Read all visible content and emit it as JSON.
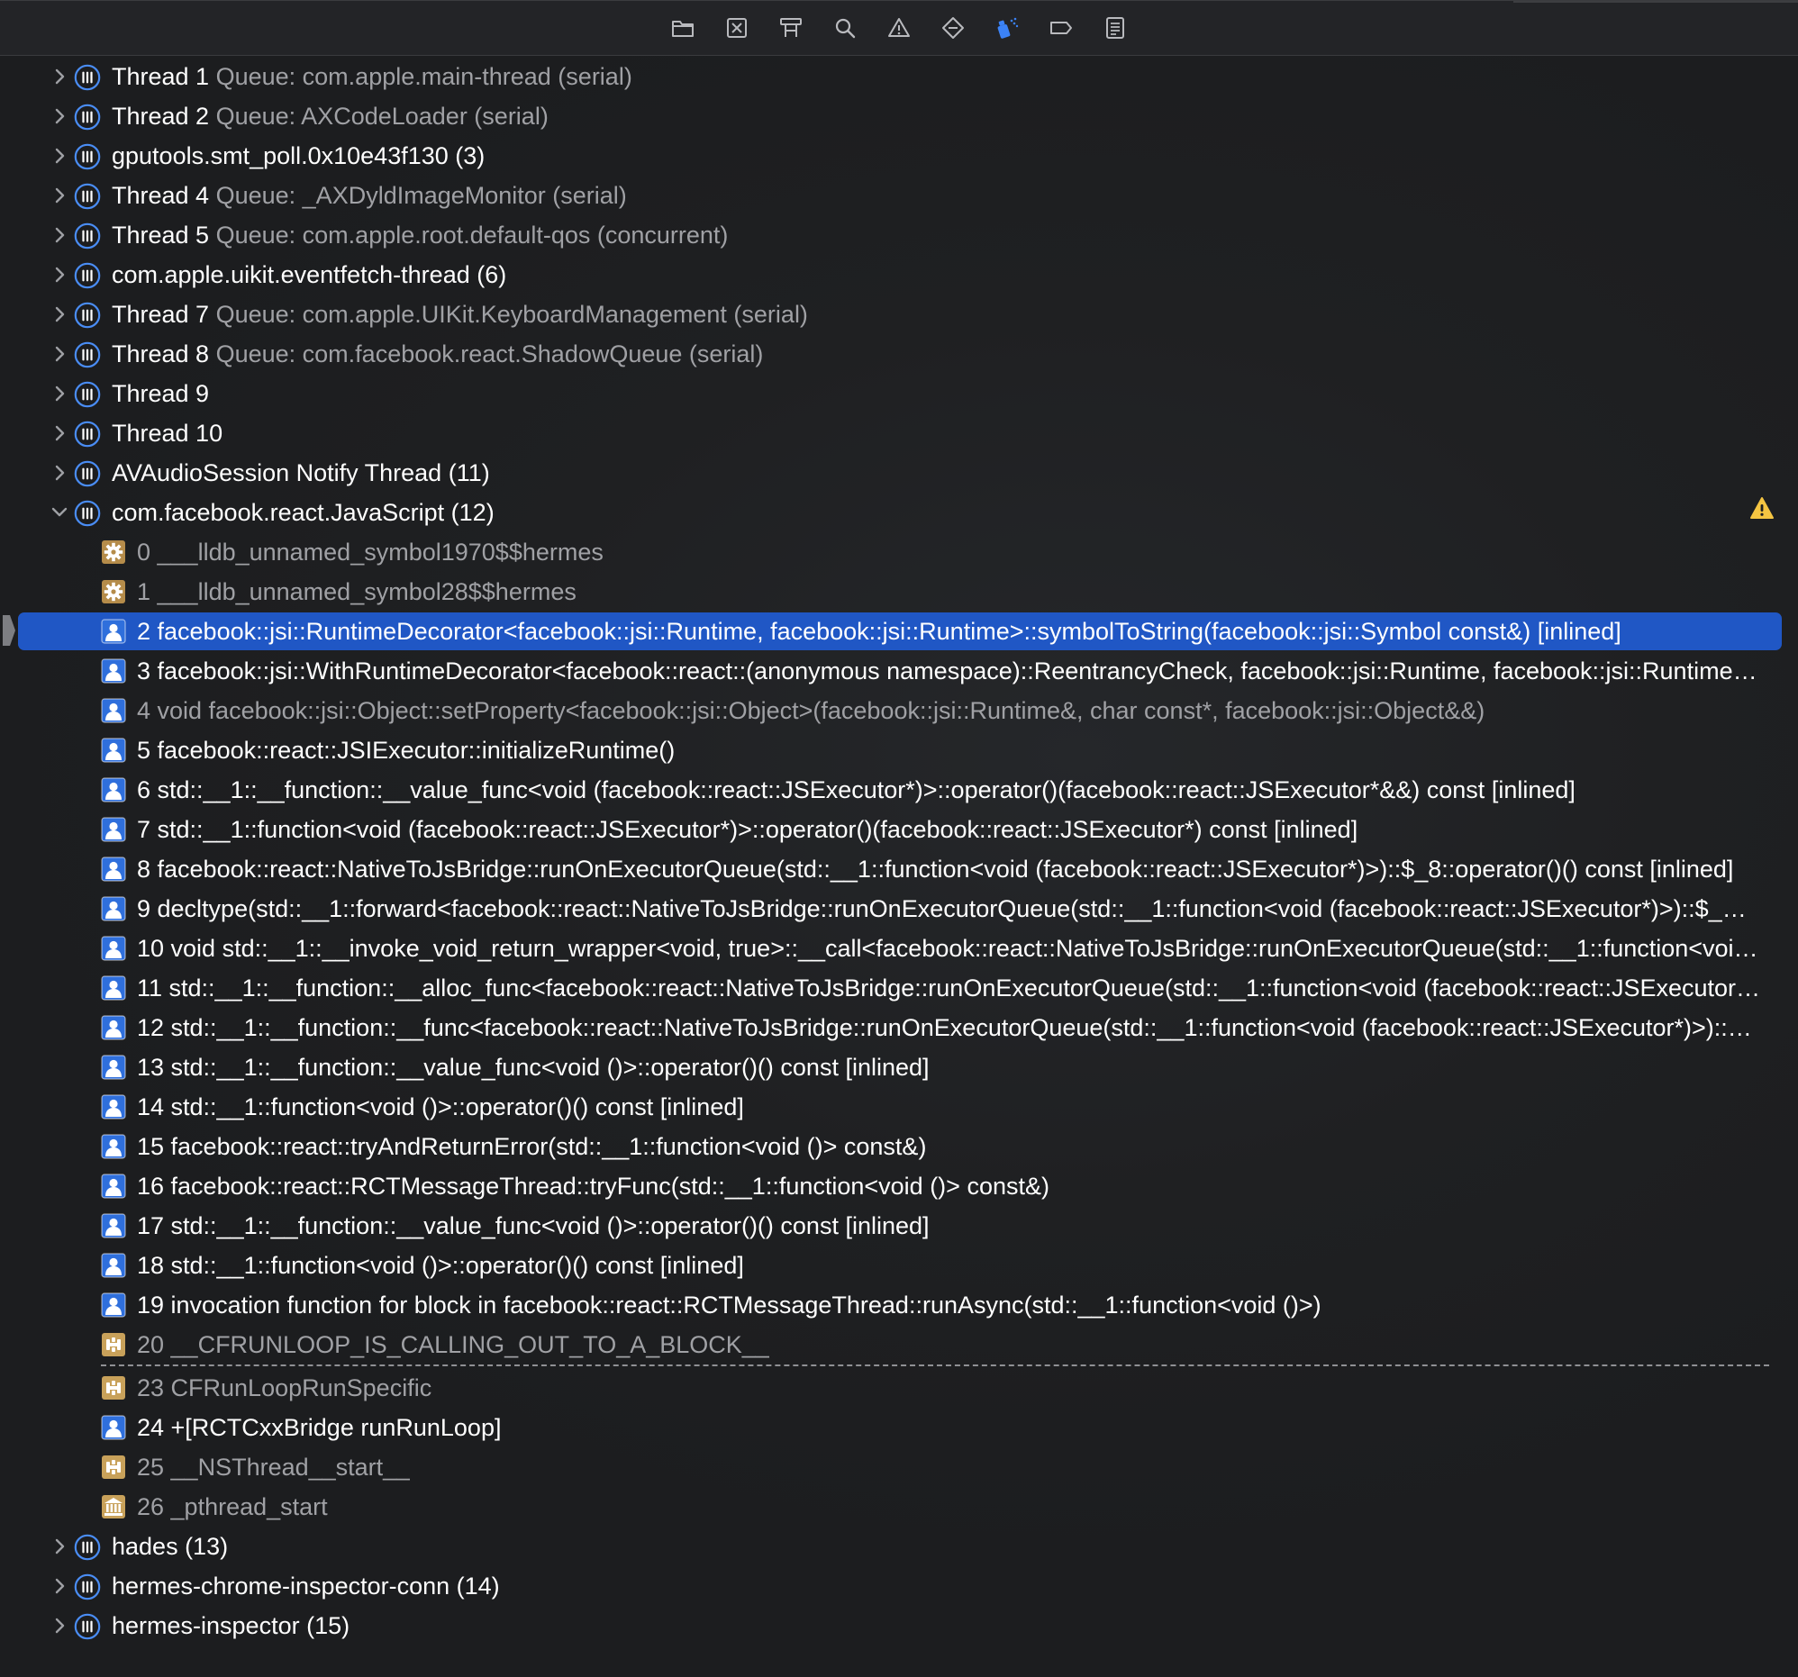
{
  "toolbar": {
    "buttons": [
      {
        "name": "project-navigator",
        "icon": "folder-icon"
      },
      {
        "name": "source-control-navigator",
        "icon": "x-square-icon"
      },
      {
        "name": "symbol-navigator",
        "icon": "hierarchy-icon"
      },
      {
        "name": "find-navigator",
        "icon": "magnifier-icon"
      },
      {
        "name": "issue-navigator",
        "icon": "warning-triangle-icon"
      },
      {
        "name": "test-navigator",
        "icon": "diamond-icon"
      },
      {
        "name": "debug-navigator",
        "icon": "spray-can-icon",
        "active": true
      },
      {
        "name": "breakpoint-navigator",
        "icon": "breakpoint-tag-icon"
      },
      {
        "name": "report-navigator",
        "icon": "list-document-icon"
      }
    ],
    "active_color": "#3b82f6"
  },
  "threads_before": [
    {
      "title": "Thread 1",
      "queue": "Queue: com.apple.main-thread (serial)"
    },
    {
      "title": "Thread 2",
      "queue": "Queue: AXCodeLoader (serial)"
    },
    {
      "title": "gputools.smt_poll.0x10e43f130 (3)",
      "queue": ""
    },
    {
      "title": "Thread 4",
      "queue": "Queue: _AXDyldImageMonitor (serial)"
    },
    {
      "title": "Thread 5",
      "queue": "Queue: com.apple.root.default-qos (concurrent)"
    },
    {
      "title": "com.apple.uikit.eventfetch-thread (6)",
      "queue": ""
    },
    {
      "title": "Thread 7",
      "queue": "Queue: com.apple.UIKit.KeyboardManagement (serial)"
    },
    {
      "title": "Thread 8",
      "queue": "Queue: com.facebook.react.ShadowQueue (serial)"
    },
    {
      "title": "Thread 9",
      "queue": ""
    },
    {
      "title": "Thread 10",
      "queue": ""
    },
    {
      "title": "AVAudioSession Notify Thread (11)",
      "queue": ""
    }
  ],
  "expanded_thread": {
    "title": "com.facebook.react.JavaScript (12)",
    "has_warning": true,
    "frames": [
      {
        "text": "0 ___lldb_unnamed_symbol1970$$hermes",
        "kind": "sys",
        "icon": "gear-icon"
      },
      {
        "text": "1 ___lldb_unnamed_symbol28$$hermes",
        "kind": "sys",
        "icon": "gear-icon"
      },
      {
        "text": "2 facebook::jsi::RuntimeDecorator<facebook::jsi::Runtime, facebook::jsi::Runtime>::symbolToString(facebook::jsi::Symbol const&) [inlined]",
        "kind": "user",
        "icon": "person-icon",
        "selected": true
      },
      {
        "text": "3 facebook::jsi::WithRuntimeDecorator<facebook::react::(anonymous namespace)::ReentrancyCheck, facebook::jsi::Runtime, facebook::jsi::Runtime…",
        "kind": "user",
        "icon": "person-icon"
      },
      {
        "text": "4 void facebook::jsi::Object::setProperty<facebook::jsi::Object>(facebook::jsi::Runtime&, char const*, facebook::jsi::Object&&)",
        "kind": "sys",
        "icon": "person-icon"
      },
      {
        "text": "5 facebook::react::JSIExecutor::initializeRuntime()",
        "kind": "user",
        "icon": "person-icon"
      },
      {
        "text": "6 std::__1::__function::__value_func<void (facebook::react::JSExecutor*)>::operator()(facebook::react::JSExecutor*&&) const [inlined]",
        "kind": "user",
        "icon": "person-icon"
      },
      {
        "text": "7 std::__1::function<void (facebook::react::JSExecutor*)>::operator()(facebook::react::JSExecutor*) const [inlined]",
        "kind": "user",
        "icon": "person-icon"
      },
      {
        "text": "8 facebook::react::NativeToJsBridge::runOnExecutorQueue(std::__1::function<void (facebook::react::JSExecutor*)>)::$_8::operator()() const [inlined]",
        "kind": "user",
        "icon": "person-icon"
      },
      {
        "text": "9 decltype(std::__1::forward<facebook::react::NativeToJsBridge::runOnExecutorQueue(std::__1::function<void (facebook::react::JSExecutor*)>)::$_…",
        "kind": "user",
        "icon": "person-icon"
      },
      {
        "text": "10 void std::__1::__invoke_void_return_wrapper<void, true>::__call<facebook::react::NativeToJsBridge::runOnExecutorQueue(std::__1::function<voi…",
        "kind": "user",
        "icon": "person-icon"
      },
      {
        "text": "11 std::__1::__function::__alloc_func<facebook::react::NativeToJsBridge::runOnExecutorQueue(std::__1::function<void (facebook::react::JSExecutor…",
        "kind": "user",
        "icon": "person-icon"
      },
      {
        "text": "12 std::__1::__function::__func<facebook::react::NativeToJsBridge::runOnExecutorQueue(std::__1::function<void (facebook::react::JSExecutor*)>)::…",
        "kind": "user",
        "icon": "person-icon"
      },
      {
        "text": "13 std::__1::__function::__value_func<void ()>::operator()() const [inlined]",
        "kind": "user",
        "icon": "person-icon"
      },
      {
        "text": "14 std::__1::function<void ()>::operator()() const [inlined]",
        "kind": "user",
        "icon": "person-icon"
      },
      {
        "text": "15 facebook::react::tryAndReturnError(std::__1::function<void ()> const&)",
        "kind": "user",
        "icon": "person-icon"
      },
      {
        "text": "16 facebook::react::RCTMessageThread::tryFunc(std::__1::function<void ()> const&)",
        "kind": "user",
        "icon": "person-icon"
      },
      {
        "text": "17 std::__1::__function::__value_func<void ()>::operator()() const [inlined]",
        "kind": "user",
        "icon": "person-icon"
      },
      {
        "text": "18 std::__1::function<void ()>::operator()() const [inlined]",
        "kind": "user",
        "icon": "person-icon"
      },
      {
        "text": "19 invocation function for block in facebook::react::RCTMessageThread::runAsync(std::__1::function<void ()>)",
        "kind": "user",
        "icon": "person-icon"
      },
      {
        "text": "20 __CFRUNLOOP_IS_CALLING_OUT_TO_A_BLOCK__",
        "kind": "sys",
        "icon": "framework-icon"
      },
      {
        "text": "23 CFRunLoopRunSpecific",
        "kind": "sys",
        "icon": "framework-icon"
      },
      {
        "text": "24 +[RCTCxxBridge runRunLoop]",
        "kind": "user",
        "icon": "person-icon"
      },
      {
        "text": "25 __NSThread__start__",
        "kind": "sys",
        "icon": "framework-icon"
      },
      {
        "text": "26 _pthread_start",
        "kind": "sys",
        "icon": "library-icon"
      }
    ]
  },
  "threads_after": [
    {
      "title": "hades (13)",
      "queue": ""
    },
    {
      "title": "hermes-chrome-inspector-conn (14)",
      "queue": ""
    },
    {
      "title": "hermes-inspector (15)",
      "queue": ""
    }
  ],
  "colors": {
    "selection": "#2057c5",
    "thread_icon": "#3b82f6",
    "user_frame_icon": "#2f6fdc",
    "framework_icon": "#c8a15a",
    "gear_icon": "#b58c4a",
    "warning": "#f5c542"
  }
}
